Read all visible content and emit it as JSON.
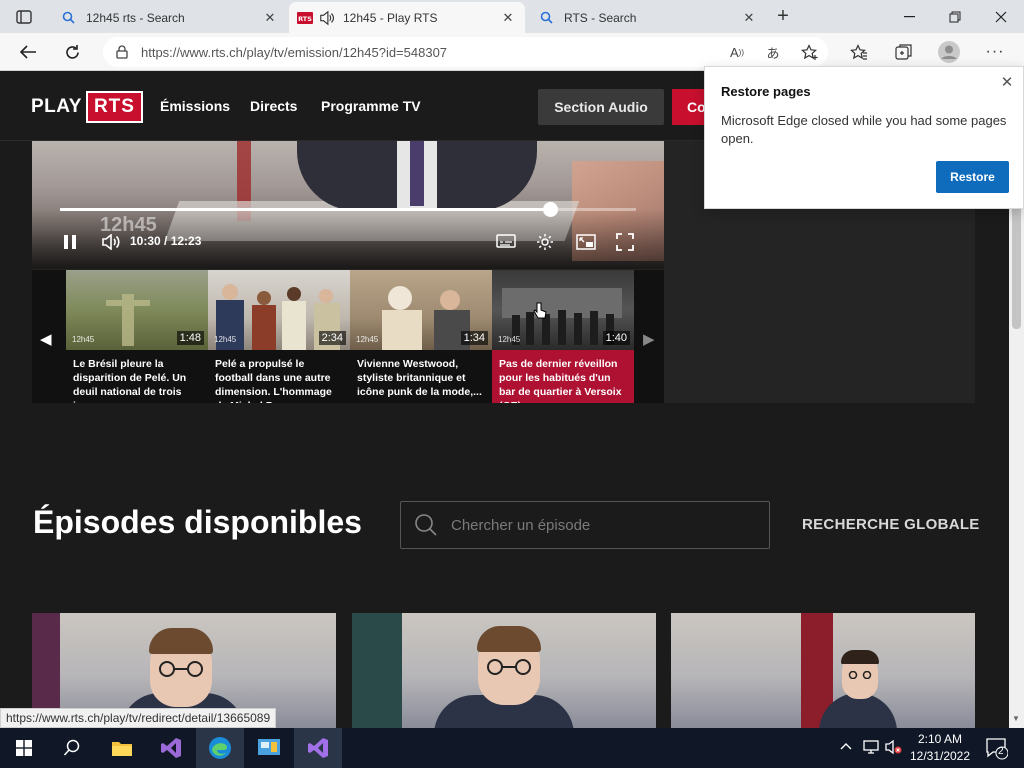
{
  "browser": {
    "tabs": [
      {
        "title": "12h45 rts - Search",
        "icon": "search-icon"
      },
      {
        "title": "12h45 - Play RTS",
        "icon": "rts-favicon"
      },
      {
        "title": "RTS - Search",
        "icon": "search-icon"
      }
    ],
    "address": "https://www.rts.ch/play/tv/emission/12h45?id=548307",
    "status_url": "https://www.rts.ch/play/tv/redirect/detail/13665089"
  },
  "site": {
    "logo_play": "PLAY",
    "logo_rts": "RTS",
    "nav": [
      "Émissions",
      "Directs",
      "Programme TV"
    ],
    "section_audio": "Section Audio",
    "red_button": "Co"
  },
  "player": {
    "time": "10:30 / 12:23",
    "progress": 0.85,
    "watermark": "12h45"
  },
  "carousel": [
    {
      "caption": "Le Brésil pleure la disparition de Pelé. Un deuil national de trois jou...",
      "duration": "1:48",
      "active": false
    },
    {
      "caption": "Pelé a propulsé le football dans une autre dimension. L'hommage de Michel Pon...",
      "duration": "2:34",
      "active": false
    },
    {
      "caption": "Vivienne Westwood, styliste britannique et icône punk de la mode,...",
      "duration": "1:34",
      "active": false
    },
    {
      "caption": "Pas de dernier réveillon pour les habitués d'un bar de quartier à Versoix (GE)",
      "duration": "1:40",
      "active": true
    }
  ],
  "episodes": {
    "title": "Épisodes disponibles",
    "search_placeholder": "Chercher un épisode",
    "global_search": "RECHERCHE GLOBALE"
  },
  "popup": {
    "title": "Restore pages",
    "message": "Microsoft Edge closed while you had some pages open.",
    "button": "Restore"
  },
  "taskbar": {
    "time": "2:10 AM",
    "date": "12/31/2022",
    "notifications": "2"
  },
  "colors": {
    "rts_red": "#c8102e",
    "edge_blue": "#0f6cbd",
    "active_caption": "#af1132"
  }
}
